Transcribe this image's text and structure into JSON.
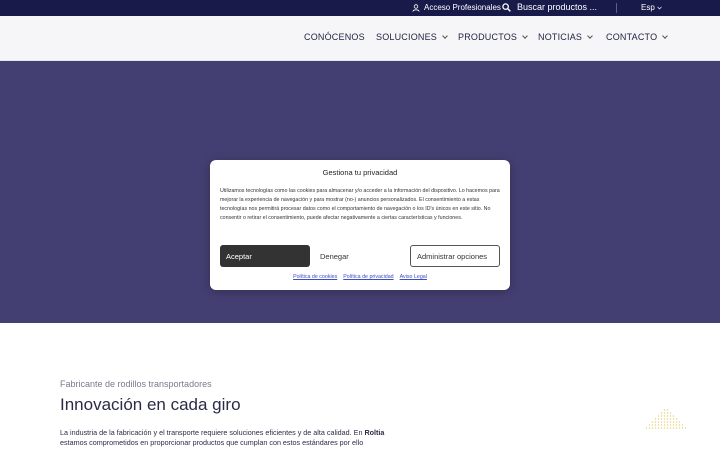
{
  "topbar": {
    "acceso_label": "Acceso Profesionales",
    "search_placeholder": "Buscar productos ...",
    "language": "Esp"
  },
  "nav": {
    "items": [
      {
        "label": "CONÓCENOS",
        "dropdown": false
      },
      {
        "label": "SOLUCIONES",
        "dropdown": true
      },
      {
        "label": "PRODUCTOS",
        "dropdown": true
      },
      {
        "label": "NOTICIAS",
        "dropdown": true
      },
      {
        "label": "CONTACTO",
        "dropdown": true
      }
    ]
  },
  "cookie_modal": {
    "title": "Gestiona tu privacidad",
    "body": "Utilizamos tecnologías como las cookies para almacenar y/o acceder a la información del dispositivo. Lo hacemos para mejorar la experiencia de navegación y para mostrar (no-) anuncios personalizados. El consentimiento a estas tecnologías nos permitirá procesar datos como el comportamiento de navegación o los ID's únicos en este sitio. No consentir o retirar el consentimiento, puede afectar negativamente a ciertas características y funciones.",
    "accept_label": "Aceptar",
    "deny_label": "Denegar",
    "manage_label": "Administrar opciones",
    "links": [
      "Política de cookies",
      "Política de privacidad",
      "Aviso Legal"
    ]
  },
  "content": {
    "eyebrow": "Fabricante de rodillos transportadores",
    "heading": "Innovación en cada giro",
    "para_part1": "La industria de la fabricación y el transporte requiere soluciones eficientes y de alta calidad. En ",
    "para_brand": "Roltia",
    "para_part2": " estamos comprometidos en proporcionar productos que cumplan con estos estándares por ello"
  },
  "colors": {
    "topbar_bg": "#181b4a",
    "hero_bg": "#433f72",
    "accept_bg": "#333333",
    "link": "#3a4cc8",
    "deco": "#e8d27a"
  },
  "icons": {
    "acceso": "user-icon",
    "search": "search-icon",
    "language": "chevron-down-icon"
  }
}
